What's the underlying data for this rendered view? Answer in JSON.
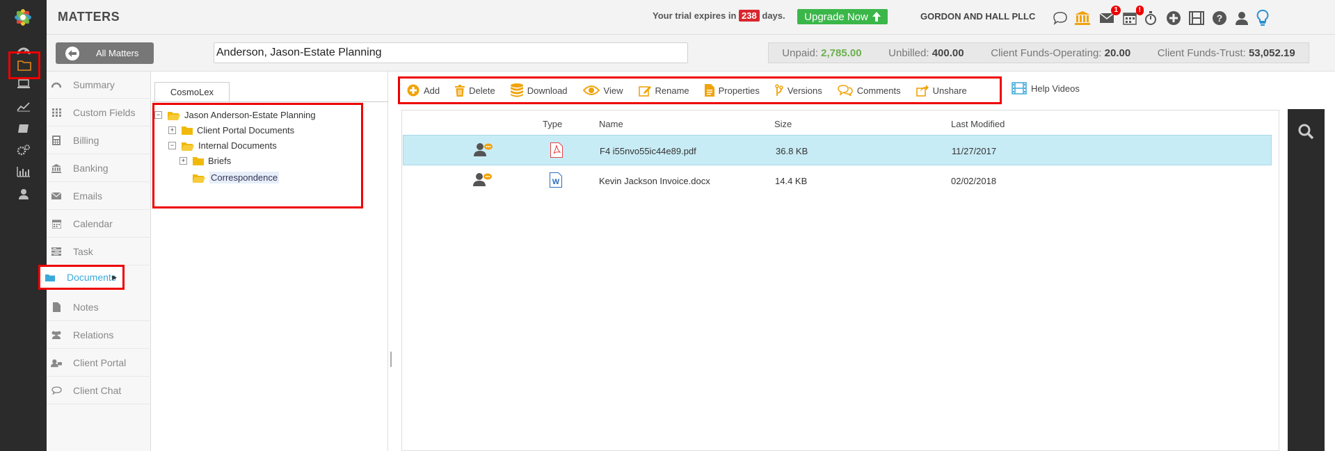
{
  "app": {
    "section_title": "MATTERS",
    "trial_prefix": "Your trial expires in",
    "trial_days": "238",
    "trial_suffix": "days.",
    "upgrade_label": "Upgrade Now",
    "firm_name": "GORDON AND HALL PLLC",
    "mail_badge": "1",
    "calendar_badge": "!"
  },
  "rail_icons": [
    "dashboard-icon",
    "folder-icon",
    "laptop-icon",
    "trend-icon",
    "book-icon",
    "gears-icon",
    "bar-chart-icon",
    "user-icon"
  ],
  "header_icons": [
    "chat-icon",
    "bank-icon",
    "mail-icon",
    "calendar-icon",
    "timer-icon",
    "plus-circle-icon",
    "film-icon",
    "help-icon",
    "user-icon",
    "lightbulb-icon"
  ],
  "matter": {
    "all_matters_label": "All Matters",
    "name": "Anderson, Jason-Estate Planning"
  },
  "financials": {
    "unpaid_label": "Unpaid:",
    "unpaid_value": "2,785.00",
    "unbilled_label": "Unbilled:",
    "unbilled_value": "400.00",
    "operating_label": "Client Funds-Operating:",
    "operating_value": "20.00",
    "trust_label": "Client Funds-Trust:",
    "trust_value": "53,052.19"
  },
  "sidenav": {
    "items": [
      {
        "label": "Summary",
        "icon": "dashboard-icon"
      },
      {
        "label": "Custom Fields",
        "icon": "grid-icon"
      },
      {
        "label": "Billing",
        "icon": "calculator-icon"
      },
      {
        "label": "Banking",
        "icon": "bank-icon"
      },
      {
        "label": "Emails",
        "icon": "envelope-icon"
      },
      {
        "label": "Calendar",
        "icon": "calendar-icon"
      },
      {
        "label": "Task",
        "icon": "task-icon"
      },
      {
        "label": "Documents",
        "icon": "folder-icon"
      },
      {
        "label": "Notes",
        "icon": "note-icon"
      },
      {
        "label": "Relations",
        "icon": "people-icon"
      },
      {
        "label": "Client Portal",
        "icon": "portal-icon"
      },
      {
        "label": "Client Chat",
        "icon": "chat-icon"
      }
    ],
    "active_index": 7
  },
  "tree": {
    "tab_label": "CosmoLex",
    "root": "Jason Anderson-Estate Planning",
    "client_portal": "Client Portal Documents",
    "internal": "Internal Documents",
    "briefs": "Briefs",
    "correspondence": "Correspondence"
  },
  "toolbar": {
    "add": "Add",
    "delete": "Delete",
    "download": "Download",
    "view": "View",
    "rename": "Rename",
    "properties": "Properties",
    "versions": "Versions",
    "comments": "Comments",
    "unshare": "Unshare",
    "help_videos": "Help Videos"
  },
  "files": {
    "columns": {
      "type": "Type",
      "name": "Name",
      "size": "Size",
      "modified": "Last Modified"
    },
    "rows": [
      {
        "name": "F4 i55nvo55ic44e89.pdf",
        "size": "36.8 KB",
        "modified": "11/27/2017",
        "filetype": "pdf-icon",
        "shared": "shared-user-icon"
      },
      {
        "name": "Kevin Jackson Invoice.docx",
        "size": "14.4 KB",
        "modified": "02/02/2018",
        "filetype": "word-icon",
        "shared": "shared-user-icon"
      }
    ]
  },
  "colors": {
    "accent_orange": "#f0a30a",
    "highlight_red": "#e00000",
    "active_blue": "#3aa9d9",
    "selected_row": "#c8ecf5",
    "upgrade_green": "#3bb74a"
  }
}
